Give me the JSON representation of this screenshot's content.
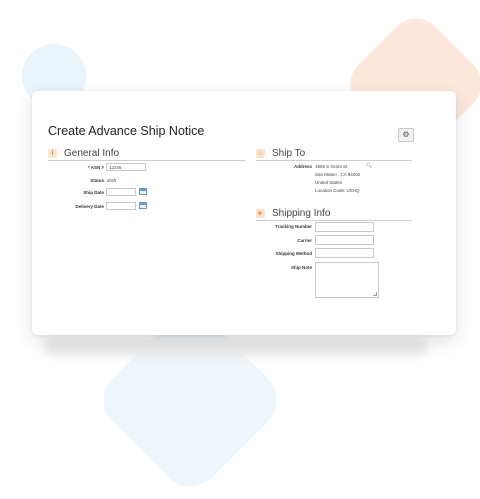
{
  "page": {
    "title": "Create Advance Ship Notice"
  },
  "toolbar": {
    "gear_icon": "⚙"
  },
  "general_info": {
    "title": "General Info",
    "asn_label": "* ASN #",
    "asn_value": "12345",
    "status_label": "Status",
    "status_value": "draft",
    "ship_date_label": "Ship Date",
    "ship_date_value": "",
    "delivery_date_label": "Delivery Date",
    "delivery_date_value": ""
  },
  "ship_to": {
    "title": "Ship To",
    "address_label": "Address",
    "address_lines": [
      "1868 S Grant St",
      "San Mateo , CA 94402",
      "United States",
      "Location Code: USHQ"
    ]
  },
  "shipping_info": {
    "title": "Shipping Info",
    "tracking_label": "Tracking Number",
    "carrier_label": "Carrier",
    "method_label": "Shipping Method",
    "note_label": "Ship Note"
  }
}
